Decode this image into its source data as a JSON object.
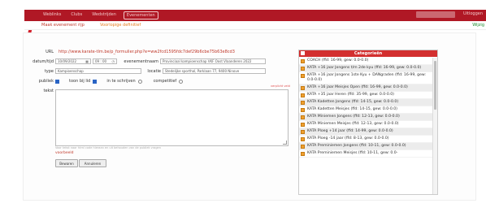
{
  "topnav": {
    "items": [
      "Weblinks",
      "Clubs",
      "Wedstrijden",
      "Evenementen"
    ],
    "active_index": 3,
    "right_item": "Uitloggen"
  },
  "subnav": {
    "new_event": "Maak evenement rijp",
    "provisional": "Voorlopige definitief",
    "right": "Wijzig"
  },
  "form": {
    "url_label": "URL",
    "url_value": "http://www.karate-tlm.be/p_formulier.php?e=ww2fcd1595fdc7def29b6cbe75b63e8cd3",
    "date_label": "datum/tijd",
    "date_value": "10/09/2022",
    "time_value": "09 : 00",
    "event_name_label": "evenementnaam",
    "event_name_value": "Provinciaal kampioenschap VKF Oost Vlaanderen 2022",
    "type_label": "type",
    "type_value": "Kampioenschap",
    "location_label": "locatie",
    "location_value": "Stedelijke sporthal, Parklaan 77, 9400 Ninove",
    "public_label": "publiek",
    "show_list_label": "toon bij lid",
    "registration_label": "in te schrijven",
    "competitive_label": "competitief",
    "text_label": "tekst",
    "required_note": "verplicht veld",
    "help_text": "Voor tekst naar html code hieraan en uit behouden van de publiek vragen",
    "example_link": "voorbeeld",
    "save_button": "Bewaren",
    "cancel_button": "Annuleren"
  },
  "categories": {
    "title": "Categorieën",
    "items": [
      "COACH (ffd: 16-99, gew: 0.0-0.0)",
      "KATA +16 jaar Jongens t/m 2de kyu (ffd: 16-99, gew: 0.0-0.0)",
      "KATA +16 jaar Jongens 1ste Kyu + DANgraden (ffd: 16-99, gew: 0.0-0.0)",
      "KATA +16 jaar Meisjes Open (ffd: 16-99, gew: 0.0-0.0)",
      "KATA +35 jaar Heren (ffd: 35-99, gew: 0.0-0.0)",
      "KATA Kadetten Jongens (ffd: 14-15, gew: 0.0-0.0)",
      "KATA Kadetten Meisjes (ffd: 14-15, gew: 0.0-0.0)",
      "KATA Miniemen Jongens (ffd: 12-13, gew: 0.0-0.0)",
      "KATA Miniemen Meisjes (ffd: 12-13, gew: 0.0-0.0)",
      "KATA Ploeg +14 jaar (ffd: 14-99, gew: 0.0-0.0)",
      "KATA Ploeg -14 jaar (ffd: 8-13, gew: 0.0-0.0)",
      "KATA Preminiemen Jongens (ffd: 10-11, gew: 0.0-0.0)",
      "KATA Preminiemen Meisjes (ffd: 10-11, gew: 0.0-"
    ]
  },
  "colors": {
    "brand_red": "#b01825",
    "header_red": "#d32f2f",
    "link_red": "#c0392b",
    "checkbox_blue": "#2a64c4"
  }
}
